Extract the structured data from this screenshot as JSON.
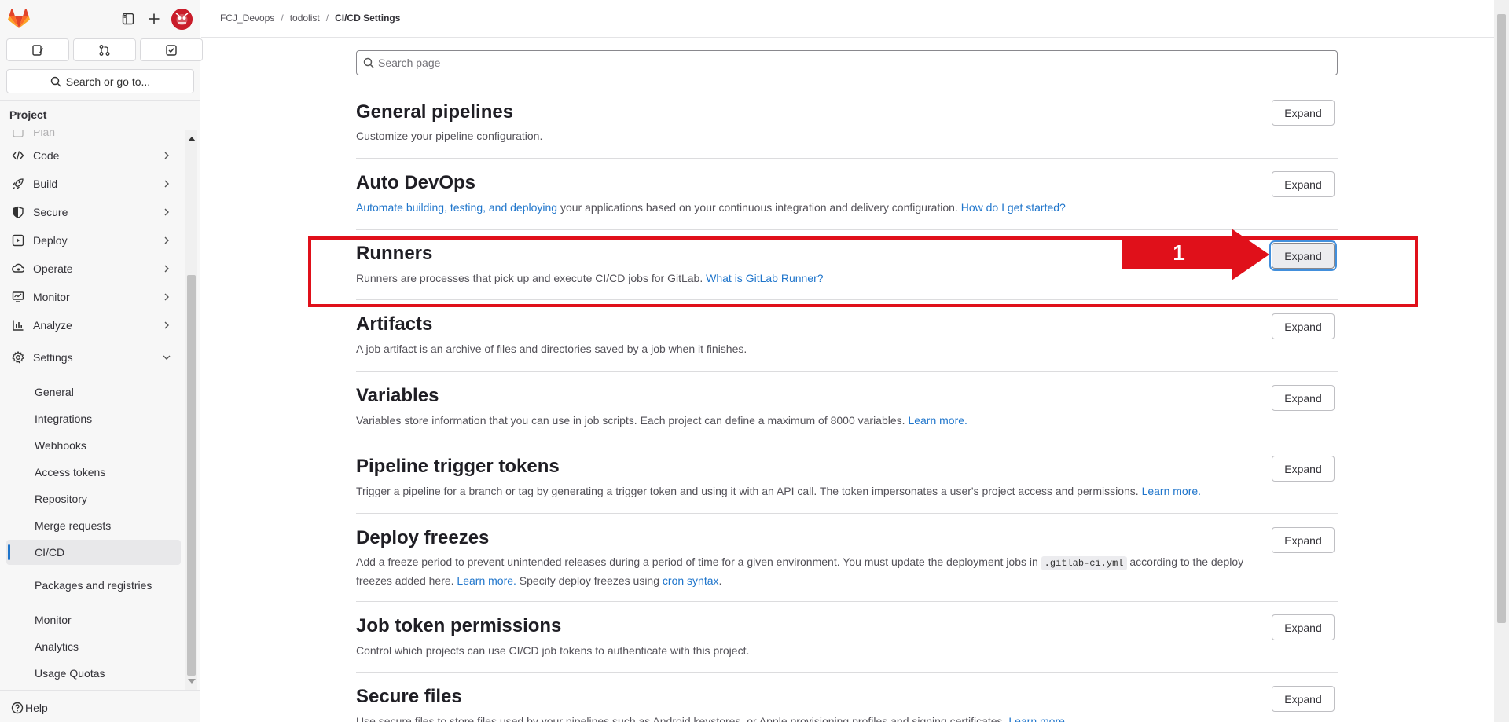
{
  "sidebar": {
    "search_label": "Search or go to...",
    "context_label": "Project",
    "partial_item_label": "Plan",
    "nav": [
      {
        "label": "Code",
        "icon": "code-icon"
      },
      {
        "label": "Build",
        "icon": "rocket-icon"
      },
      {
        "label": "Secure",
        "icon": "shield-icon"
      },
      {
        "label": "Deploy",
        "icon": "deploy-icon"
      },
      {
        "label": "Operate",
        "icon": "cloud-gear-icon"
      },
      {
        "label": "Monitor",
        "icon": "monitor-icon"
      },
      {
        "label": "Analyze",
        "icon": "chart-icon"
      },
      {
        "label": "Settings",
        "icon": "gear-icon"
      }
    ],
    "settings_items": [
      "General",
      "Integrations",
      "Webhooks",
      "Access tokens",
      "Repository",
      "Merge requests",
      "CI/CD",
      "Packages and registries",
      "Monitor",
      "Analytics",
      "Usage Quotas"
    ],
    "active_item": "CI/CD",
    "help_label": "Help"
  },
  "breadcrumbs": {
    "items": [
      "FCJ_Devops",
      "todolist",
      "CI/CD Settings"
    ]
  },
  "search": {
    "placeholder": "Search page"
  },
  "expand_label": "Expand",
  "sections": {
    "general_pipelines": {
      "title": "General pipelines",
      "desc": "Customize your pipeline configuration."
    },
    "auto_devops": {
      "title": "Auto DevOps",
      "link1": "Automate building, testing, and deploying",
      "text1": " your applications based on your continuous integration and delivery configuration. ",
      "link2": "How do I get started?"
    },
    "runners": {
      "title": "Runners",
      "text1": "Runners are processes that pick up and execute CI/CD jobs for GitLab. ",
      "link1": "What is GitLab Runner?"
    },
    "artifacts": {
      "title": "Artifacts",
      "desc": "A job artifact is an archive of files and directories saved by a job when it finishes."
    },
    "variables": {
      "title": "Variables",
      "text1": "Variables store information that you can use in job scripts. Each project can define a maximum of 8000 variables. ",
      "link1": "Learn more."
    },
    "pipeline_trigger_tokens": {
      "title": "Pipeline trigger tokens",
      "text1": "Trigger a pipeline for a branch or tag by generating a trigger token and using it with an API call. The token impersonates a user's project access and permissions. ",
      "link1": "Learn more."
    },
    "deploy_freezes": {
      "title": "Deploy freezes",
      "text1": "Add a freeze period to prevent unintended releases during a period of time for a given environment. You must update the deployment jobs in ",
      "code": ".gitlab-ci.yml",
      "text2": " according to the deploy freezes added here. ",
      "link1": "Learn more.",
      "text3": " Specify deploy freezes using ",
      "link2": "cron syntax",
      "text4": "."
    },
    "job_token_permissions": {
      "title": "Job token permissions",
      "desc": "Control which projects can use CI/CD job tokens to authenticate with this project."
    },
    "secure_files": {
      "title": "Secure files",
      "text1": "Use secure files to store files used by your pipelines such as Android keystores, or Apple provisioning profiles and signing certificates. ",
      "link1": "Learn more."
    }
  },
  "annotation": {
    "step_number": "1",
    "color": "#e0101a"
  },
  "colors": {
    "link": "#1f75cb",
    "active_indicator": "#1f75cb",
    "logo_orange": "#e24329",
    "avatar_red": "#c91c2a"
  }
}
